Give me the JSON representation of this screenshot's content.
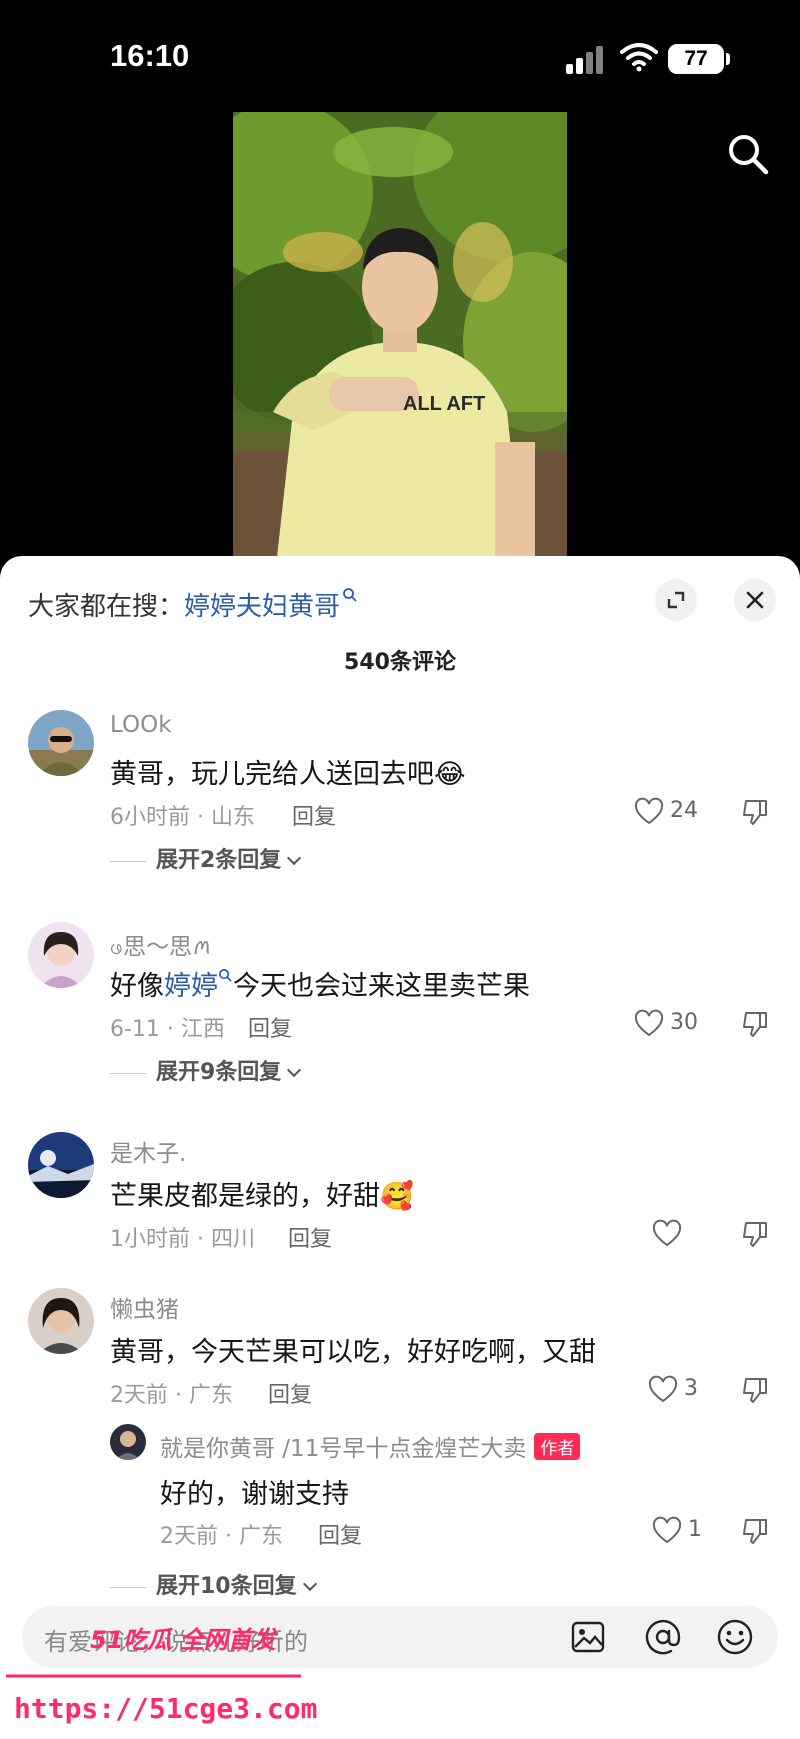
{
  "status_bar": {
    "time": "16:10",
    "battery": "77"
  },
  "hot_search": {
    "prefix": "大家都在搜：",
    "keyword": "婷婷夫妇黄哥"
  },
  "comment_count": "540条评论",
  "comments": [
    {
      "username": "LOOk",
      "text": "黄哥，玩儿完给人送回去吧",
      "emoji": "😂",
      "time_location": "6小时前 · 山东",
      "reply_label": "回复",
      "likes": "24",
      "expand": "展开2条回复"
    },
    {
      "username": "ဖ思～思ꪔ",
      "text_before": "好像",
      "keyword": "婷婷",
      "text_after": "今天也会过来这里卖芒果",
      "time_location": "6-11 · 江西",
      "reply_label": "回复",
      "likes": "30",
      "expand": "展开9条回复"
    },
    {
      "username": "是木子.",
      "text": "芒果皮都是绿的，好甜",
      "emoji": "🥰",
      "time_location": "1小时前 · 四川",
      "reply_label": "回复",
      "likes": ""
    },
    {
      "username": "懒虫猪",
      "text": "黄哥，今天芒果可以吃，好好吃啊，又甜",
      "time_location": "2天前 · 广东",
      "reply_label": "回复",
      "likes": "3"
    }
  ],
  "sub_reply": {
    "username": "就是你黄哥 /11号早十点金煌芒大卖",
    "badge": "作者",
    "text": "好的，谢谢支持",
    "time_location": "2天前 · 广东",
    "reply_label": "回复",
    "likes": "1",
    "expand": "展开10条回复"
  },
  "input": {
    "placeholder": "有爱评论，说点儿好听的"
  },
  "watermark": {
    "brand": "51吃瓜 全网首发",
    "url": "https://51cge3.com"
  }
}
